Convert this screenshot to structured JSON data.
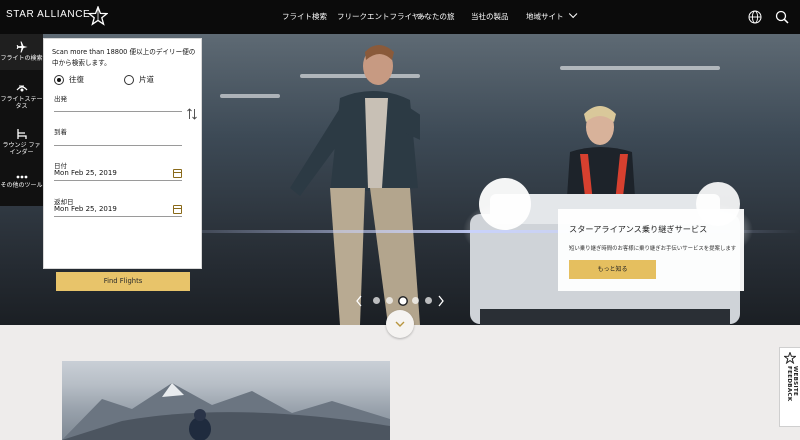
{
  "header": {
    "logo_text": "STAR ALLIANCE",
    "nav": [
      "フライト検索",
      "フリークエントフライヤー",
      "あなたの旅",
      "当社の製品",
      "地域サイト"
    ],
    "icons": [
      "globe-icon",
      "search-icon"
    ]
  },
  "sidebar": {
    "items": [
      {
        "label": "フライトの検索",
        "icon": "airplane-icon"
      },
      {
        "label": "フライトステータス",
        "icon": "flight-status-icon"
      },
      {
        "label": "ラウンジ ファインダー",
        "icon": "lounge-chair-icon"
      },
      {
        "label": "その他のツール",
        "icon": "more-dots-icon"
      }
    ]
  },
  "search": {
    "intro": "Scan more than 18800 便以上のデイリー便の中から検索します。",
    "trip_types": [
      "往復",
      "片道"
    ],
    "selected_trip": "往復",
    "from_label": "出発",
    "to_label": "到着",
    "date_label": "日付",
    "date_value": "Mon Feb 25, 2019",
    "return_label": "返却日",
    "return_value": "Mon Feb 25, 2019",
    "submit_label": "Find Flights"
  },
  "hero_card": {
    "title": "スターアライアンス乗り継ぎサービス",
    "desc": "短い乗り継ぎ時間のお客様に乗り継ぎお手伝いサービスを提案します",
    "button": "もっと知る"
  },
  "carousel": {
    "count": 5,
    "active_index": 3
  },
  "feedback": {
    "label": "WEBSITE\nFEEDBACK"
  },
  "colors": {
    "accent": "#e8c46a",
    "topbar": "#0b0b0b",
    "page_bg": "#eeeceb"
  }
}
